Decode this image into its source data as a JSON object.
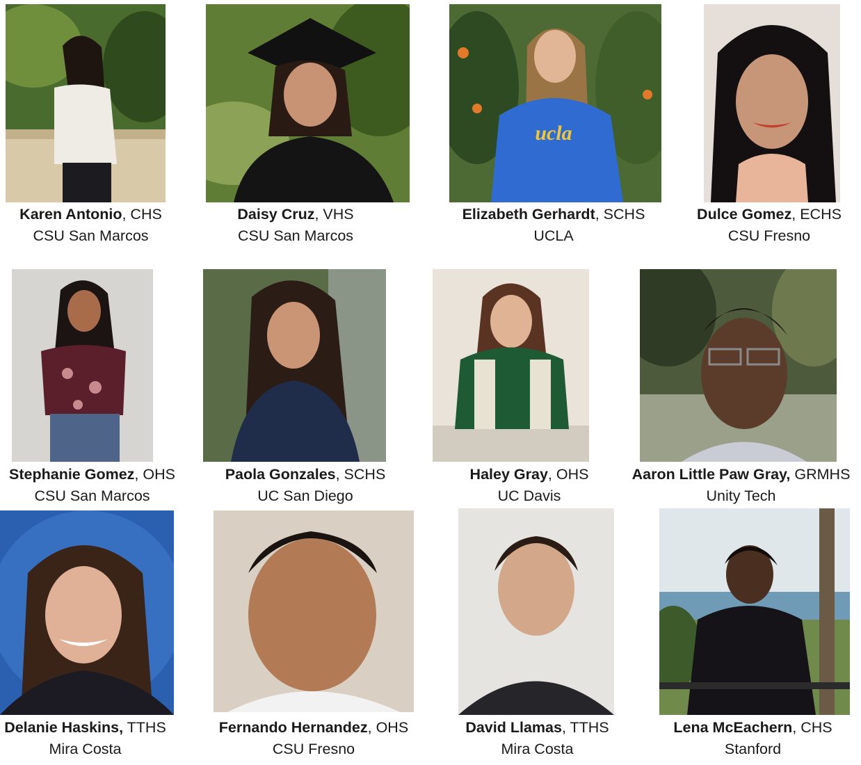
{
  "students": [
    {
      "name": "Karen Antonio",
      "school_suffix": ", CHS",
      "college": "CSU San Marcos"
    },
    {
      "name": "Daisy Cruz",
      "school_suffix": ", VHS",
      "college": "CSU San Marcos"
    },
    {
      "name": "Elizabeth Gerhardt",
      "school_suffix": ", SCHS",
      "college": "UCLA"
    },
    {
      "name": "Dulce Gomez",
      "school_suffix": ", ECHS",
      "college": "CSU Fresno"
    },
    {
      "name": "Stephanie Gomez",
      "school_suffix": ", OHS",
      "college": "CSU San Marcos"
    },
    {
      "name": "Paola Gonzales",
      "school_suffix": ", SCHS",
      "college": "UC San Diego"
    },
    {
      "name": "Haley Gray",
      "school_suffix": ", OHS",
      "college": "UC Davis"
    },
    {
      "name": "Aaron Little Paw Gray,",
      "school_suffix": " GRMHS",
      "college": "Unity Tech"
    },
    {
      "name": "Delanie Haskins,",
      "school_suffix": " TTHS",
      "college": "Mira Costa"
    },
    {
      "name": "Fernando Hernandez",
      "school_suffix": ", OHS",
      "college": "CSU Fresno"
    },
    {
      "name": "David Llamas",
      "school_suffix": ", TTHS",
      "college": "Mira Costa"
    },
    {
      "name": "Lena McEachern",
      "school_suffix": ", CHS",
      "college": "Stanford"
    }
  ],
  "photo_text": {
    "sweatshirt": "ucla"
  }
}
